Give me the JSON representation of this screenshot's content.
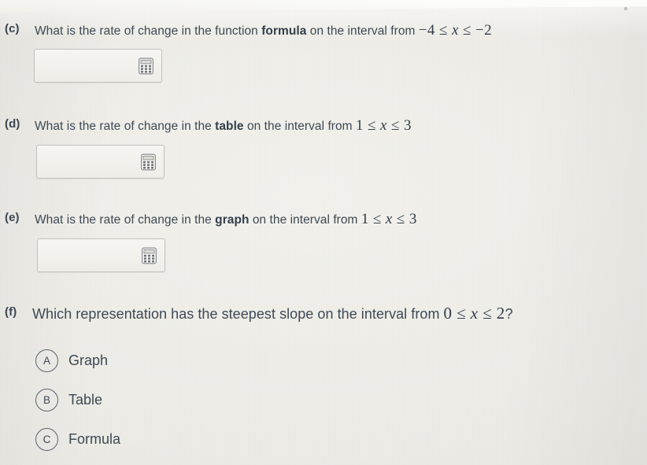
{
  "document": {
    "type": "math-worksheet-question-set"
  },
  "questions": [
    {
      "label": "(c)",
      "text_before": "What is the rate of change in the function ",
      "bold": "formula",
      "text_after": " on the interval from ",
      "math": "−4 ≤ x ≤ −2",
      "math_lhs": "−4",
      "math_rel1": "≤",
      "math_var": "x",
      "math_rel2": "≤",
      "math_rhs": "−2",
      "trailing": "",
      "input": {
        "value": "",
        "placeholder": "",
        "icon": "calculator-icon"
      }
    },
    {
      "label": "(d)",
      "text_before": "What is the rate of change in the ",
      "bold": "table",
      "text_after": " on the interval from ",
      "math": "1 ≤ x ≤ 3",
      "math_lhs": "1",
      "math_rel1": "≤",
      "math_var": "x",
      "math_rel2": "≤",
      "math_rhs": "3",
      "trailing": "",
      "input": {
        "value": "",
        "placeholder": "",
        "icon": "calculator-icon"
      }
    },
    {
      "label": "(e)",
      "text_before": "What is the rate of change in the ",
      "bold": "graph",
      "text_after": " on the interval from ",
      "math": "1 ≤ x ≤ 3",
      "math_lhs": "1",
      "math_rel1": "≤",
      "math_var": "x",
      "math_rel2": "≤",
      "math_rhs": "3",
      "trailing": "",
      "input": {
        "value": "",
        "placeholder": "",
        "icon": "calculator-icon"
      }
    },
    {
      "label": "(f)",
      "text_before": "Which representation has the steepest slope on the interval from ",
      "bold": "",
      "text_after": "",
      "math": "0 ≤ x ≤ 2",
      "math_lhs": "0",
      "math_rel1": "≤",
      "math_var": "x",
      "math_rel2": "≤",
      "math_rhs": "2",
      "trailing": "?",
      "choices": [
        {
          "letter": "A",
          "label": "Graph"
        },
        {
          "letter": "B",
          "label": "Table"
        },
        {
          "letter": "C",
          "label": "Formula"
        }
      ]
    }
  ],
  "colors": {
    "background": "#edece7",
    "text": "#3e4953",
    "box_border": "#c2c1bb",
    "bubble_border": "#5d666f"
  }
}
